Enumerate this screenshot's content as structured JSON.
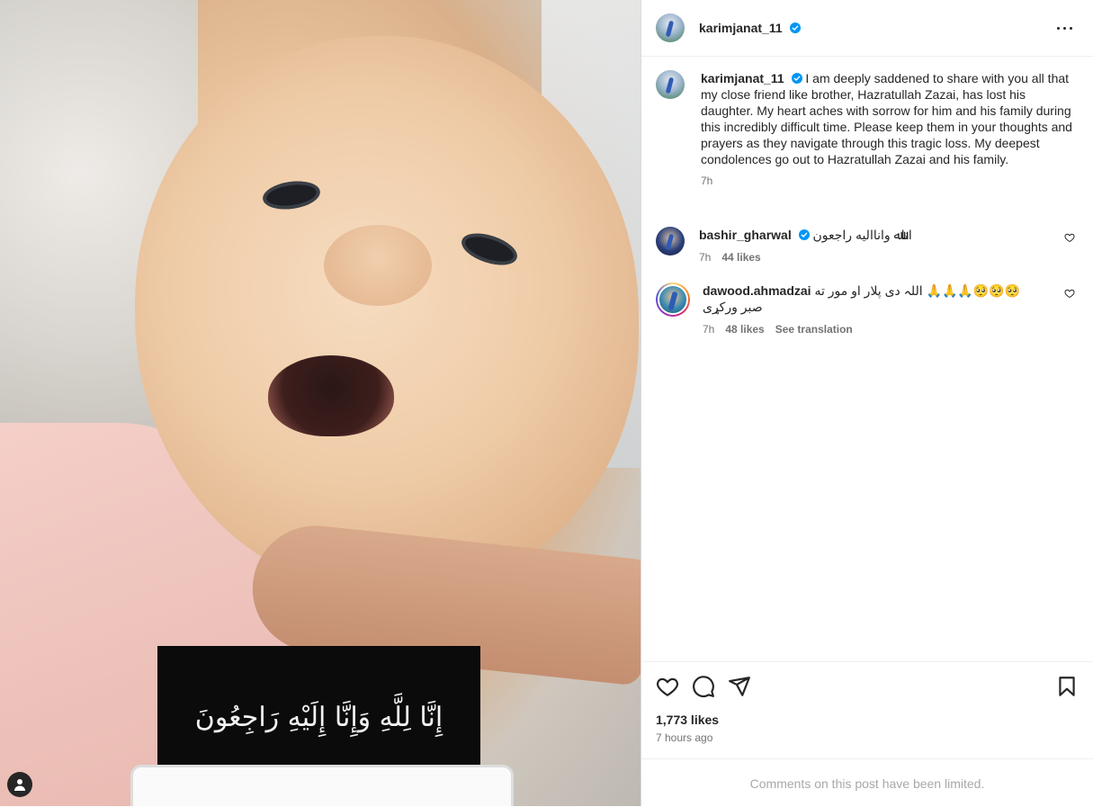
{
  "header": {
    "username": "karimjanat_11"
  },
  "media": {
    "overlay_text": "إِنَّا لِلَّهِ وَإِنَّا إِلَيْهِ رَاجِعُونَ"
  },
  "caption": {
    "username": "karimjanat_11",
    "text": "I am deeply saddened to share with you all that my close friend like brother, Hazratullah Zazai, has lost his daughter. My heart aches with sorrow for him and his family during this incredibly difficult time. Please keep them in your thoughts and prayers as they navigate through this tragic loss. My deepest condolences go out to Hazratullah Zazai and his family.",
    "time": "7h"
  },
  "comments": [
    {
      "username": "bashir_gharwal",
      "text": "اناﷲ واناالیه راجعون",
      "time": "7h",
      "likes": "44 likes"
    },
    {
      "username": "dawood.ahmadzai",
      "text": "🥺🥺🥺🙏🙏🙏 اللہ دی پلار او مور ته صبر ورکړی",
      "time": "7h",
      "likes": "48 likes",
      "translate": "See translation"
    }
  ],
  "post": {
    "likes": "1,773 likes",
    "time_ago": "7 hours ago",
    "comments_limited": "Comments on this post have been limited."
  },
  "icons": {
    "verified": "verified-badge-icon",
    "more": "more-options-icon",
    "like": "heart-icon",
    "comment": "comment-icon",
    "share": "share-icon",
    "save": "bookmark-icon",
    "user_tag": "user-tag-icon"
  },
  "colors": {
    "verified_blue": "#0095f6",
    "text": "#262626",
    "secondary": "#737373"
  }
}
